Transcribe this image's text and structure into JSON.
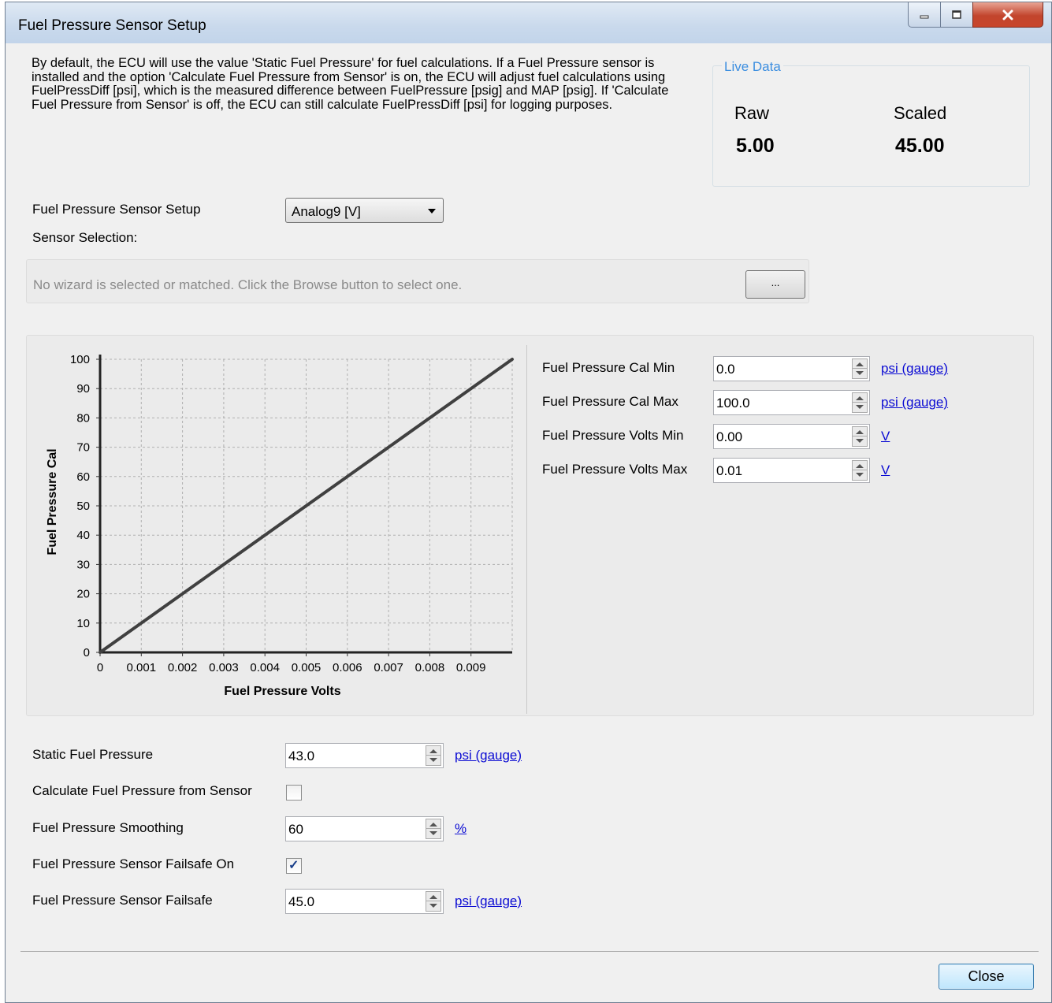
{
  "window": {
    "title": "Fuel Pressure Sensor Setup",
    "controls": [
      "minimize",
      "maximize",
      "close"
    ]
  },
  "description": "By default, the ECU will use the value 'Static Fuel Pressure' for fuel calculations. If a Fuel Pressure sensor is installed and the option 'Calculate Fuel Pressure from Sensor' is on, the ECU will adjust fuel calculations using FuelPressDiff [psi], which is the measured difference between FuelPressure [psig] and MAP [psig]. If 'Calculate Fuel Pressure from Sensor' is off, the ECU can still calculate FuelPressDiff [psi] for logging purposes.",
  "live_data": {
    "title": "Live Data",
    "raw_label": "Raw",
    "raw_value": "5.00",
    "scaled_label": "Scaled",
    "scaled_value": "45.00"
  },
  "sensor_setup": {
    "label": "Fuel Pressure Sensor Setup",
    "selected": "Analog9 [V]",
    "selection_label": "Sensor Selection:",
    "wizard_text": "No wizard is selected or matched. Click the Browse button to select one.",
    "browse_label": "..."
  },
  "calibration": {
    "fields": [
      {
        "label": "Fuel Pressure Cal Min",
        "value": "0.0",
        "unit": "psi (gauge)"
      },
      {
        "label": "Fuel Pressure Cal Max",
        "value": "100.0",
        "unit": "psi (gauge)"
      },
      {
        "label": "Fuel Pressure Volts Min",
        "value": "0.00",
        "unit": "V"
      },
      {
        "label": "Fuel Pressure Volts Max",
        "value": "0.01",
        "unit": "V"
      }
    ]
  },
  "chart_data": {
    "type": "line",
    "xlabel": "Fuel Pressure Volts",
    "ylabel": "Fuel Pressure Cal",
    "xlim": [
      0,
      0.01
    ],
    "ylim": [
      0,
      100
    ],
    "x_ticks": [
      "0",
      "0.001",
      "0.002",
      "0.003",
      "0.004",
      "0.005",
      "0.006",
      "0.007",
      "0.008",
      "0.009"
    ],
    "y_ticks": [
      "0",
      "10",
      "20",
      "30",
      "40",
      "50",
      "60",
      "70",
      "80",
      "90",
      "100"
    ],
    "grid": true,
    "series": [
      {
        "x": [
          0,
          0.01
        ],
        "y": [
          0,
          100
        ],
        "color": "#404040"
      }
    ]
  },
  "settings": {
    "static_fuel_pressure": {
      "label": "Static Fuel Pressure",
      "value": "43.0",
      "unit": "psi (gauge)"
    },
    "calc_from_sensor": {
      "label": "Calculate Fuel Pressure from Sensor",
      "checked": false
    },
    "smoothing": {
      "label": "Fuel Pressure Smoothing",
      "value": "60",
      "unit": "%"
    },
    "failsafe_on": {
      "label": "Fuel Pressure Sensor Failsafe On",
      "checked": true
    },
    "failsafe": {
      "label": "Fuel Pressure Sensor Failsafe",
      "value": "45.0",
      "unit": "psi (gauge)"
    }
  },
  "footer": {
    "close_label": "Close"
  }
}
